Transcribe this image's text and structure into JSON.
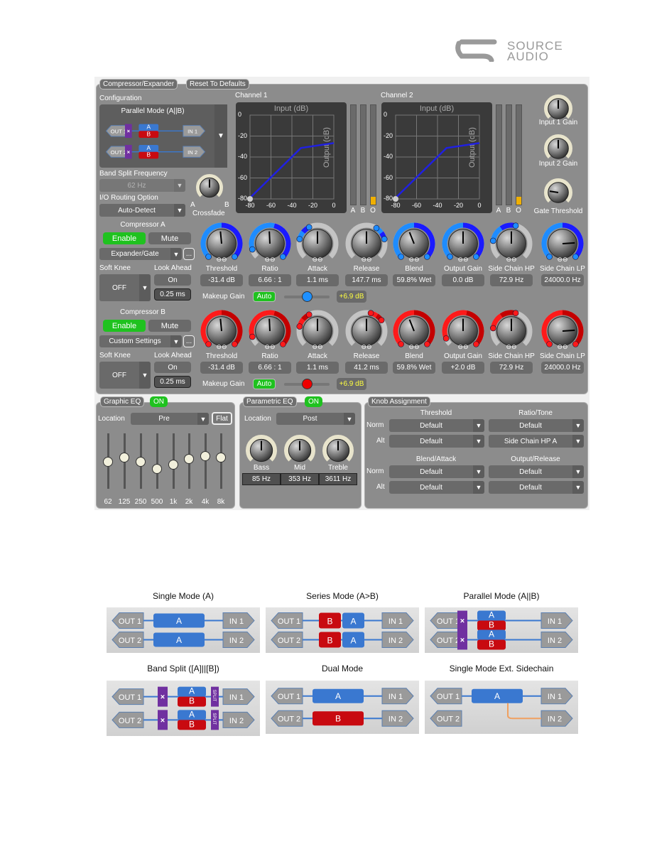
{
  "logo": {
    "line1": "SOURCE",
    "line2": "AUDIO"
  },
  "tabs": {
    "main": "Compressor/Expander",
    "reset": "Reset To Defaults"
  },
  "config": {
    "label": "Configuration",
    "mode": "Parallel Mode (A||B)",
    "out1": "OUT 1",
    "out2": "OUT 2",
    "in1": "IN 1",
    "in2": "IN 2",
    "a": "A",
    "b": "B",
    "mix": "×",
    "band_split_label": "Band Split Frequency",
    "band_split_value": "62 Hz",
    "routing_label": "I/O Routing Option",
    "routing_value": "Auto-Detect",
    "crossfade_label": "Crossfade",
    "crossfade_a": "A",
    "crossfade_b": "B",
    "crossfade_level": 0.5
  },
  "graphs": [
    {
      "title": "Channel 1",
      "xlabel": "Input (dB)",
      "ylabel": "Output (dB)",
      "ticks": [
        "0",
        "-20",
        "-40",
        "-60",
        "-80"
      ],
      "xticks": [
        "-80",
        "-60",
        "-40",
        "-20",
        "0"
      ],
      "curve": [
        [
          -80,
          -79
        ],
        [
          -31.4,
          -31.4
        ],
        [
          0,
          -26.7
        ]
      ],
      "meters": [
        "A",
        "B",
        "O"
      ],
      "meter_levels": [
        0,
        0,
        0.08
      ]
    },
    {
      "title": "Channel 2",
      "xlabel": "Input (dB)",
      "ylabel": "Output (dB)",
      "ticks": [
        "0",
        "-20",
        "-40",
        "-60",
        "-80"
      ],
      "xticks": [
        "-80",
        "-60",
        "-40",
        "-20",
        "0"
      ],
      "curve": [
        [
          -80,
          -79
        ],
        [
          -31.4,
          -31.4
        ],
        [
          0,
          -26.7
        ]
      ],
      "meters": [
        "A",
        "B",
        "O"
      ],
      "meter_levels": [
        0,
        0,
        0.08
      ]
    }
  ],
  "side_knobs": [
    {
      "label": "Input 1 Gain",
      "level": 0.5
    },
    {
      "label": "Input 2 Gain",
      "level": 0.5
    },
    {
      "label": "Gate Threshold",
      "level": 0.2
    }
  ],
  "compressors": [
    {
      "title": "Compressor A",
      "enable": "Enable",
      "mute": "Mute",
      "preset": "Expander/Gate",
      "more": "...",
      "soft_knee_label": "Soft Knee",
      "soft_knee": "OFF",
      "look_ahead_label": "Look Ahead",
      "look_ahead": "On",
      "look_ahead_time": "0.25 ms",
      "makeup_label": "Makeup Gain",
      "makeup_auto": "Auto",
      "makeup_value": "+6.9 dB",
      "makeup_level": 0.5,
      "color": "#1a1aff",
      "color2": "#1e8cff",
      "knobs": [
        {
          "label": "Threshold",
          "value": "-31.4 dB",
          "level": 0.48,
          "range": [
            0,
            1
          ]
        },
        {
          "label": "Ratio",
          "value": "6.66 : 1",
          "level": 0.49,
          "range": [
            0.1,
            1
          ]
        },
        {
          "label": "Attack",
          "value": "1.1 ms",
          "level": 0.5,
          "range": [
            0.22,
            0.4
          ]
        },
        {
          "label": "Release",
          "value": "147.7 ms",
          "level": 0.5,
          "range": [
            0.62,
            0.78
          ]
        },
        {
          "label": "Blend",
          "value": "59.8% Wet",
          "level": 0.42,
          "range": [
            0,
            1
          ]
        },
        {
          "label": "Output Gain",
          "value": "0.0 dB",
          "level": 0.5,
          "range": [
            0,
            1
          ]
        },
        {
          "label": "Side Chain HP",
          "value": "72.9 Hz",
          "level": 0.5,
          "range": [
            0.2,
            0.55
          ]
        },
        {
          "label": "Side Chain LP",
          "value": "24000.0 Hz",
          "level": 0.82,
          "range": [
            0,
            1
          ]
        }
      ]
    },
    {
      "title": "Compressor B",
      "enable": "Enable",
      "mute": "Mute",
      "preset": "Custom Settings",
      "more": "...",
      "soft_knee_label": "Soft Knee",
      "soft_knee": "OFF",
      "look_ahead_label": "Look Ahead",
      "look_ahead": "On",
      "look_ahead_time": "0.25 ms",
      "makeup_label": "Makeup Gain",
      "makeup_auto": "Auto",
      "makeup_value": "+6.9 dB",
      "makeup_level": 0.5,
      "color": "#c40000",
      "color2": "#ff1a1a",
      "knobs": [
        {
          "label": "Threshold",
          "value": "-31.4 dB",
          "level": 0.48,
          "range": [
            0,
            1
          ]
        },
        {
          "label": "Ratio",
          "value": "6.66 : 1",
          "level": 0.49,
          "range": [
            0.1,
            1
          ]
        },
        {
          "label": "Attack",
          "value": "1.1 ms",
          "level": 0.5,
          "range": [
            0.22,
            0.4
          ]
        },
        {
          "label": "Release",
          "value": "41.2 ms",
          "level": 0.5,
          "range": [
            0.55,
            0.7
          ]
        },
        {
          "label": "Blend",
          "value": "59.8% Wet",
          "level": 0.42,
          "range": [
            0,
            1
          ]
        },
        {
          "label": "Output Gain",
          "value": "+2.0 dB",
          "level": 0.5,
          "range": [
            0.08,
            1
          ]
        },
        {
          "label": "Side Chain HP",
          "value": "72.9 Hz",
          "level": 0.5,
          "range": [
            0.2,
            0.55
          ]
        },
        {
          "label": "Side Chain LP",
          "value": "24000.0 Hz",
          "level": 0.82,
          "range": [
            0,
            1
          ]
        }
      ]
    }
  ],
  "graphic_eq": {
    "title": "Graphic EQ",
    "state": "ON",
    "location_label": "Location",
    "location": "Pre",
    "flat": "Flat",
    "bands": [
      {
        "label": "62",
        "level": 0.49
      },
      {
        "label": "125",
        "level": 0.56
      },
      {
        "label": "250",
        "level": 0.49
      },
      {
        "label": "500",
        "level": 0.36
      },
      {
        "label": "1k",
        "level": 0.44
      },
      {
        "label": "2k",
        "level": 0.54
      },
      {
        "label": "4k",
        "level": 0.59
      },
      {
        "label": "8k",
        "level": 0.56
      }
    ]
  },
  "parametric_eq": {
    "title": "Parametric EQ",
    "state": "ON",
    "location_label": "Location",
    "location": "Post",
    "knobs": [
      {
        "label": "Bass",
        "value": "85 Hz",
        "level": 0.5
      },
      {
        "label": "Mid",
        "value": "353 Hz",
        "level": 0.5
      },
      {
        "label": "Treble",
        "value": "3611 Hz",
        "level": 0.5
      }
    ]
  },
  "knob_assignment": {
    "title": "Knob Assignment",
    "norm": "Norm",
    "alt": "Alt",
    "groups": [
      {
        "title": "Threshold",
        "norm": "Default",
        "alt": "Default"
      },
      {
        "title": "Ratio/Tone",
        "norm": "Default",
        "alt": "Side Chain HP A"
      },
      {
        "title": "Blend/Attack",
        "norm": "Default",
        "alt": "Default"
      },
      {
        "title": "Output/Release",
        "norm": "Default",
        "alt": "Default"
      }
    ]
  },
  "diagrams": [
    {
      "title": "Single Mode (A)",
      "type": "single"
    },
    {
      "title": "Series Mode (A>B)",
      "type": "series"
    },
    {
      "title": "Parallel Mode (A||B)",
      "type": "parallel"
    },
    {
      "title": "Band Split ([A]||[B])",
      "type": "split",
      "split": "SPLIT"
    },
    {
      "title": "Dual Mode",
      "type": "dual"
    },
    {
      "title": "Single Mode Ext. Sidechain",
      "type": "sidechain"
    }
  ]
}
